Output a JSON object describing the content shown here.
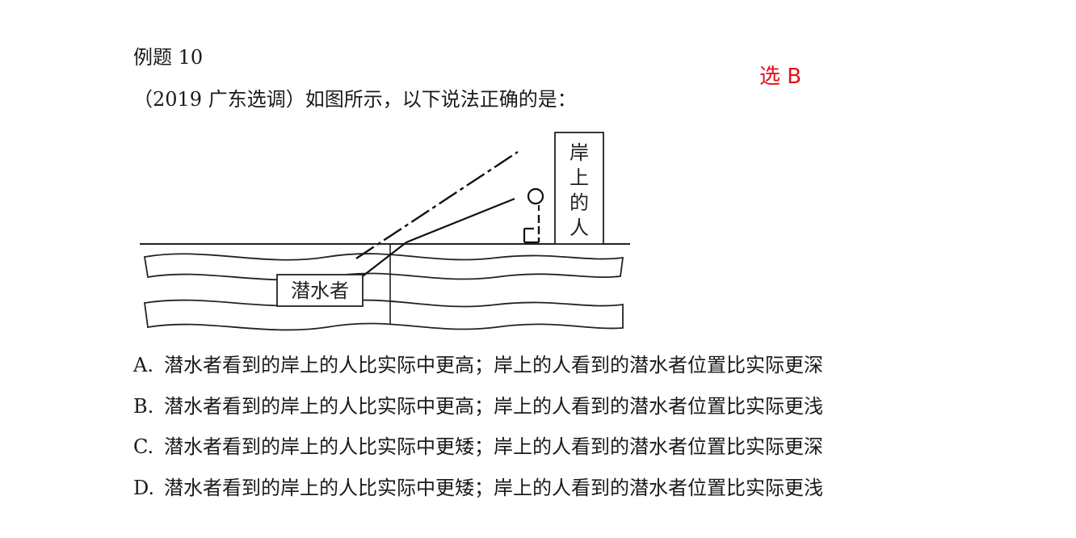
{
  "question": {
    "title": "例题 10",
    "source": "（2019 广东选调）如图所示，以下说法正确的是：",
    "answer_note": "选 B"
  },
  "diagram": {
    "person_label_chars": [
      "岸",
      "上",
      "的",
      "人"
    ],
    "diver_label": "潜水者"
  },
  "options": [
    {
      "letter": "A.",
      "text": "潜水者看到的岸上的人比实际中更高；岸上的人看到的潜水者位置比实际更深"
    },
    {
      "letter": "B.",
      "text": "潜水者看到的岸上的人比实际中更高；岸上的人看到的潜水者位置比实际更浅"
    },
    {
      "letter": "C.",
      "text": "潜水者看到的岸上的人比实际中更矮；岸上的人看到的潜水者位置比实际更深"
    },
    {
      "letter": "D.",
      "text": "潜水者看到的岸上的人比实际中更矮；岸上的人看到的潜水者位置比实际更浅"
    }
  ]
}
